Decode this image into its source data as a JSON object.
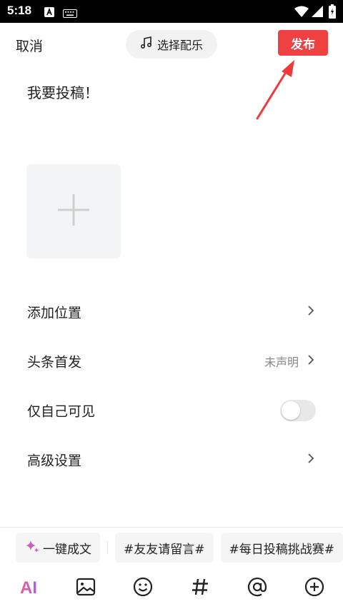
{
  "status_bar": {
    "time": "5:18"
  },
  "header": {
    "cancel_label": "取消",
    "music_label": "选择配乐",
    "publish_label": "发布"
  },
  "composer": {
    "text": "我要投稿！"
  },
  "settings": {
    "location_label": "添加位置",
    "first_publish_label": "头条首发",
    "first_publish_value": "未声明",
    "private_label": "仅自己可见",
    "private_enabled": false,
    "advanced_label": "高级设置"
  },
  "chips": {
    "ai_write": "一键成文",
    "topic_1": "#友友请留言#",
    "topic_2": "#每日投稿挑战赛#"
  },
  "toolbar": {
    "ai_label": "AI"
  },
  "colors": {
    "publish_bg": "#f04142",
    "annotation_arrow": "#f03a3a",
    "ai_gradient_start": "#f05a8c",
    "ai_gradient_end": "#b25df0"
  },
  "icons": [
    "music-note-icon",
    "plus-icon",
    "chevron-right-icon",
    "sparkle-icon",
    "image-icon",
    "emoji-icon",
    "hashtag-icon",
    "at-icon",
    "add-circle-icon",
    "wifi-icon",
    "signal-icon",
    "battery-icon"
  ]
}
